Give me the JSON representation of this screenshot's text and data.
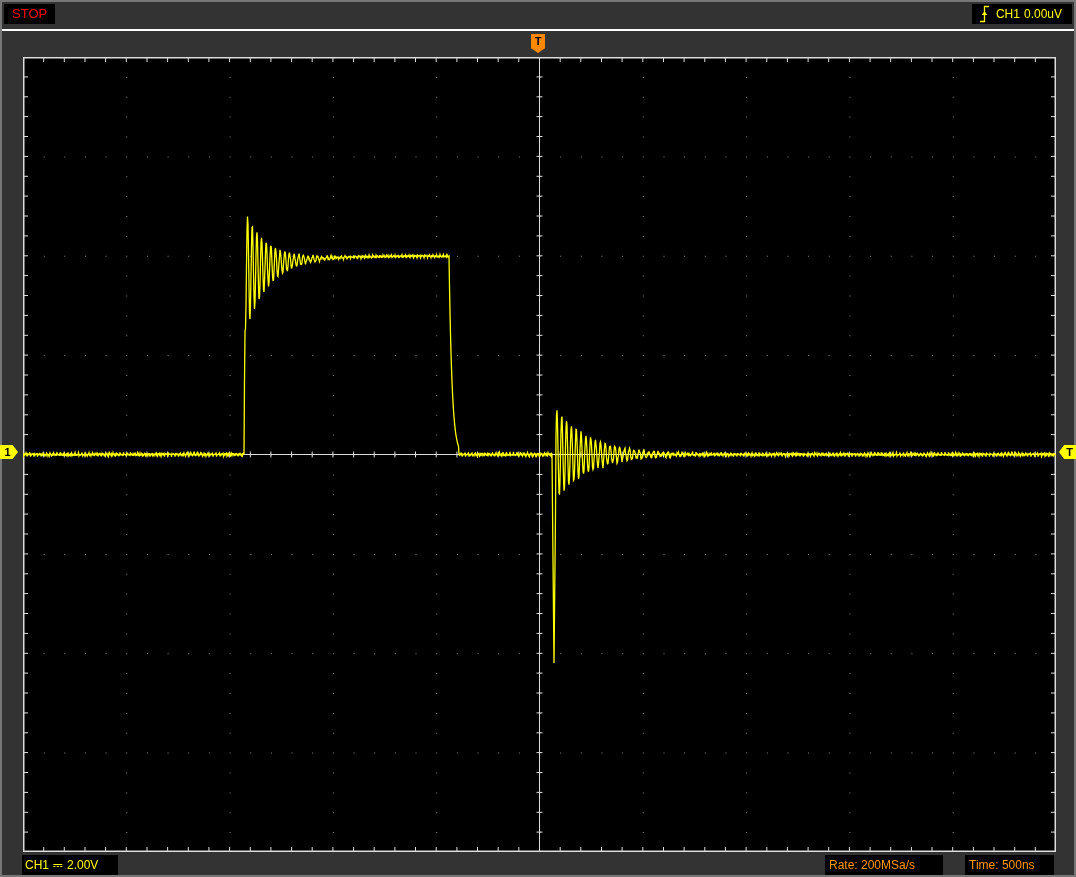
{
  "status": {
    "text": "STOP"
  },
  "trigger_readout": {
    "channel": "CH1",
    "level": "0.00uV"
  },
  "markers": {
    "trigger_position": "T",
    "channel": "1",
    "trigger_level": "T"
  },
  "channel_readout": {
    "channel": "CH1",
    "coupling": "⎓",
    "scale": "2.00V"
  },
  "rate": "Rate: 200MSa/s",
  "timebase": "Time: 500ns"
}
